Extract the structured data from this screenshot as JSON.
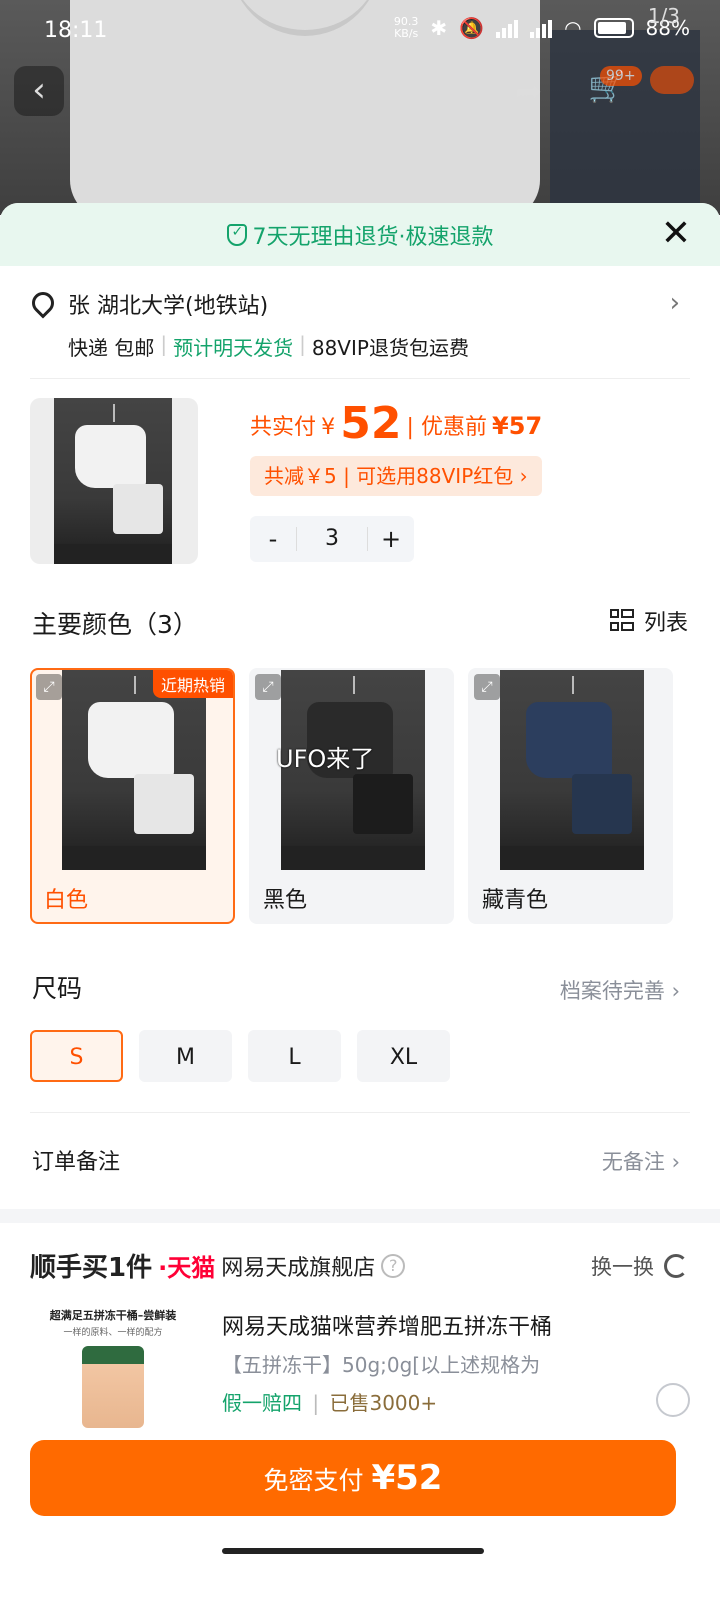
{
  "status_bar": {
    "time": "18:11",
    "net_speed_top": "90.3",
    "net_speed_unit": "KB/s",
    "battery": "88%"
  },
  "header": {
    "pager": "1/3",
    "cart_badge": "99+"
  },
  "banner": {
    "text": "7天无理由退货·极速退款"
  },
  "address": {
    "line": "张 湖北大学(地铁站)",
    "shipping": "快递 包邮",
    "dispatch": "预计明天发货",
    "vip": "88VIP退货包运费"
  },
  "price": {
    "paid_label": "共实付",
    "currency": "¥",
    "paid_value": "52",
    "pre_label": "优惠前",
    "pre_value": "¥57",
    "coupon": "共减￥5 | 可选用88VIP红包 ›",
    "quantity": "3"
  },
  "colors": {
    "title": "主要颜色（3）",
    "list_label": "列表",
    "hot_tag": "近期热销",
    "watermark": "UFO来了",
    "options": [
      {
        "name": "白色",
        "shirt": "#f2f2f2",
        "short": "#e6e6e6",
        "selected": true
      },
      {
        "name": "黑色",
        "shirt": "#2a2a2a",
        "short": "#1c1c1c",
        "selected": false
      },
      {
        "name": "藏青色",
        "shirt": "#2c3e5e",
        "short": "#26364f",
        "selected": false
      }
    ]
  },
  "size": {
    "title": "尺码",
    "profile": "档案待完善 ›",
    "options": [
      "S",
      "M",
      "L",
      "XL"
    ],
    "selected": "S"
  },
  "remark": {
    "title": "订单备注",
    "value": "无备注 ›"
  },
  "upsell": {
    "brand": "顺手买1件",
    "platform": "天猫",
    "shop": "网易天成旗舰店",
    "swap": "换一换",
    "img_caption": "超满足五拼冻干桶–尝鲜装",
    "img_sub": "一样的原料、一样的配方",
    "title": "网易天成猫咪营养增肥五拼冻干桶",
    "spec": "【五拼冻干】50g;0g[以上述规格为",
    "guarantee": "假一赔四",
    "sold": "已售3000+"
  },
  "pay": {
    "label": "免密支付",
    "amount": "¥52"
  },
  "colors_theme": {
    "accent": "#ff5000",
    "green": "#14a36b"
  }
}
